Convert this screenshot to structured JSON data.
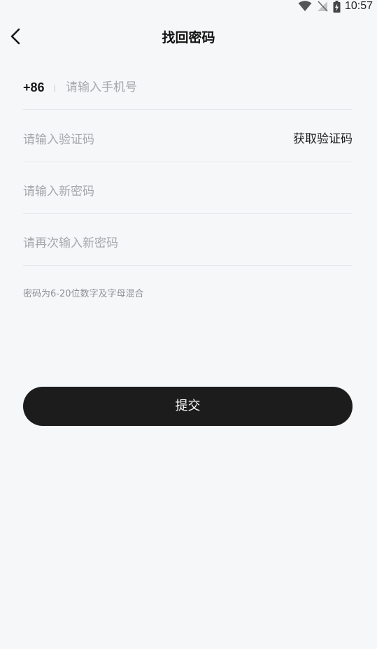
{
  "status_bar": {
    "time": "10:57"
  },
  "header": {
    "title": "找回密码"
  },
  "form": {
    "country_code": "+86",
    "phone_placeholder": "请输入手机号",
    "code_placeholder": "请输入验证码",
    "get_code_label": "获取验证码",
    "new_password_placeholder": "请输入新密码",
    "confirm_password_placeholder": "请再次输入新密码",
    "hint": "密码为6-20位数字及字母混合",
    "submit_label": "提交"
  },
  "icons": {
    "back": "chevron-left-icon",
    "wifi": "wifi-icon",
    "signal": "no-signal-icon",
    "battery": "battery-charging-icon"
  },
  "colors": {
    "background": "#f6f7f9",
    "button": "#1c1c1c",
    "placeholder": "#a5a7ab",
    "divider": "#e6e7ea"
  }
}
